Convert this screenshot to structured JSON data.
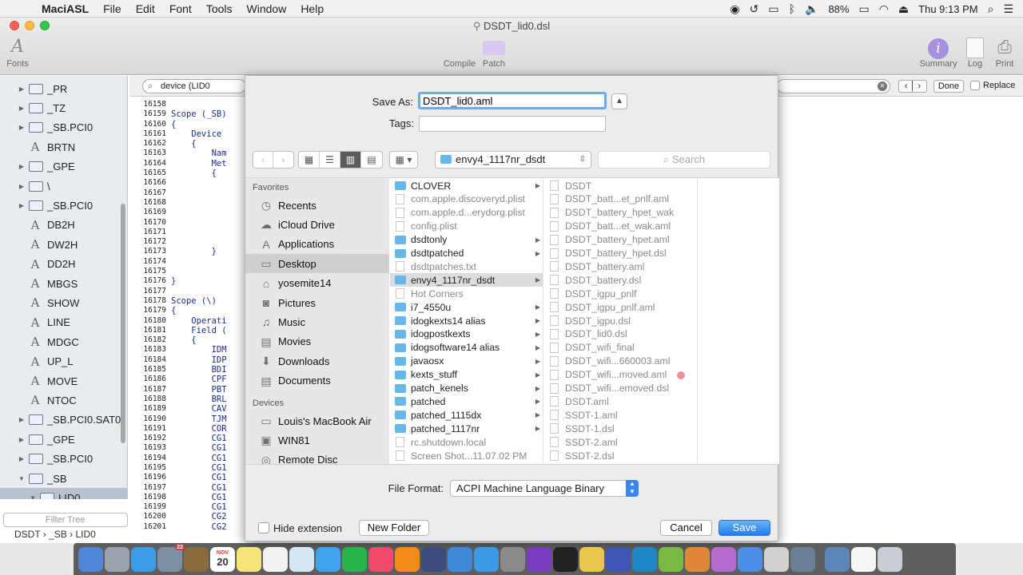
{
  "menubar": {
    "app_name": "MaciASL",
    "menus": [
      "File",
      "Edit",
      "Font",
      "Tools",
      "Window",
      "Help"
    ],
    "battery": "88%",
    "clock": "Thu 9:13 PM"
  },
  "window": {
    "title": "DSDT_lid0.dsl",
    "toolbar": {
      "fonts": "Fonts",
      "compile": "Compile",
      "patch": "Patch",
      "summary": "Summary",
      "log": "Log",
      "print": "Print"
    }
  },
  "tree": {
    "rows": [
      {
        "label": "_PR",
        "kind": "folder",
        "disc": "▶"
      },
      {
        "label": "_TZ",
        "kind": "folder",
        "disc": "▶"
      },
      {
        "label": "_SB.PCI0",
        "kind": "folder",
        "disc": "▶"
      },
      {
        "label": "BRTN",
        "kind": "method",
        "disc": ""
      },
      {
        "label": "_GPE",
        "kind": "folder",
        "disc": "▶"
      },
      {
        "label": "\\",
        "kind": "folder",
        "disc": "▶"
      },
      {
        "label": "_SB.PCI0",
        "kind": "folder",
        "disc": "▶"
      },
      {
        "label": "DB2H",
        "kind": "method",
        "disc": ""
      },
      {
        "label": "DW2H",
        "kind": "method",
        "disc": ""
      },
      {
        "label": "DD2H",
        "kind": "method",
        "disc": ""
      },
      {
        "label": "MBGS",
        "kind": "method",
        "disc": ""
      },
      {
        "label": "SHOW",
        "kind": "method",
        "disc": ""
      },
      {
        "label": "LINE",
        "kind": "method",
        "disc": ""
      },
      {
        "label": "MDGC",
        "kind": "method",
        "disc": ""
      },
      {
        "label": "UP_L",
        "kind": "method",
        "disc": ""
      },
      {
        "label": "MOVE",
        "kind": "method",
        "disc": ""
      },
      {
        "label": "NTOC",
        "kind": "method",
        "disc": ""
      },
      {
        "label": "_SB.PCI0.SAT0",
        "kind": "folder",
        "disc": "▶"
      },
      {
        "label": "_GPE",
        "kind": "folder",
        "disc": "▶"
      },
      {
        "label": "_SB.PCI0",
        "kind": "folder",
        "disc": "▶"
      },
      {
        "label": "_SB",
        "kind": "folder",
        "disc": "▼"
      },
      {
        "label": "LID0",
        "kind": "folder",
        "disc": "▼",
        "selected": true
      }
    ],
    "filter_placeholder": "Filter Tree",
    "breadcrumbs": "DSDT › _SB › LID0"
  },
  "find_bar": {
    "query": "device (LID0",
    "done": "Done",
    "replace": "Replace"
  },
  "editor": {
    "line_numbers": [
      "16158",
      "16159",
      "16160",
      "16161",
      "16162",
      "16163",
      "16164",
      "16165",
      "16166",
      "16167",
      "16168",
      "16169",
      "16170",
      "16171",
      "16172",
      "16173",
      "16174",
      "16175",
      "16176",
      "16177",
      "16178",
      "16179",
      "16180",
      "16181",
      "16182",
      "16183",
      "16184",
      "16185",
      "16186",
      "16187",
      "16188",
      "16189",
      "16190",
      "16191",
      "16192",
      "16193",
      "16194",
      "16195",
      "16196",
      "16197",
      "16198",
      "16199",
      "16200",
      "16201"
    ],
    "code_lines": [
      "",
      "Scope (_SB)",
      "{",
      "    Device",
      "    {",
      "        Nam",
      "        Met",
      "        {",
      "",
      "",
      "",
      "",
      "",
      "",
      "",
      "        }",
      "",
      "",
      "}",
      "",
      "Scope (\\)",
      "{",
      "    Operati",
      "    Field (",
      "    {",
      "        IDM",
      "        IDP",
      "        BDI",
      "        CPF",
      "        PBT",
      "        BRL",
      "        CAV",
      "        TJM",
      "        COR",
      "        CG1",
      "        CG1",
      "        CG1",
      "        CG1",
      "        CG1",
      "        CG1",
      "        CG1",
      "        CG1",
      "        CG2",
      "        CG2"
    ]
  },
  "save_sheet": {
    "save_as_label": "Save As:",
    "save_as_value": "DSDT_lid0.aml",
    "tags_label": "Tags:",
    "location": "envy4_1117nr_dsdt",
    "search_placeholder": "Search",
    "favorites_header": "Favorites",
    "favorites": [
      "Recents",
      "iCloud Drive",
      "Applications",
      "Desktop",
      "yosemite14",
      "Pictures",
      "Music",
      "Movies",
      "Downloads",
      "Documents"
    ],
    "devices_header": "Devices",
    "devices": [
      "Louis's MacBook Air",
      "WIN81",
      "Remote Disc"
    ],
    "column1": [
      {
        "name": "CLOVER",
        "type": "folder",
        "arrow": true
      },
      {
        "name": "com.apple.discoveryd.plist",
        "type": "file"
      },
      {
        "name": "com.apple.d...erydorg.plist",
        "type": "file"
      },
      {
        "name": "config.plist",
        "type": "file"
      },
      {
        "name": "dsdtonly",
        "type": "folder",
        "arrow": true
      },
      {
        "name": "dsdtpatched",
        "type": "folder",
        "arrow": true
      },
      {
        "name": "dsdtpatches.txt",
        "type": "file"
      },
      {
        "name": "envy4_1117nr_dsdt",
        "type": "folder",
        "arrow": true,
        "selected": true
      },
      {
        "name": "Hot Corners",
        "type": "file"
      },
      {
        "name": "i7_4550u",
        "type": "folder",
        "arrow": true
      },
      {
        "name": "idogkexts14 alias",
        "type": "folder",
        "arrow": true
      },
      {
        "name": "idogpostkexts",
        "type": "folder",
        "arrow": true
      },
      {
        "name": "idogsoftware14 alias",
        "type": "folder",
        "arrow": true
      },
      {
        "name": "javaosx",
        "type": "folder",
        "arrow": true
      },
      {
        "name": "kexts_stuff",
        "type": "folder",
        "arrow": true
      },
      {
        "name": "patch_kenels",
        "type": "folder",
        "arrow": true
      },
      {
        "name": "patched",
        "type": "folder",
        "arrow": true
      },
      {
        "name": "patched_1115dx",
        "type": "folder",
        "arrow": true
      },
      {
        "name": "patched_1117nr",
        "type": "folder",
        "arrow": true
      },
      {
        "name": "rc.shutdown.local",
        "type": "file"
      },
      {
        "name": "Screen Shot...11.07.02 PM",
        "type": "file"
      }
    ],
    "column2": [
      "DSDT",
      "DSDT_batt...et_pnlf.aml",
      "DSDT_battery_hpet_wak",
      "DSDT_batt...et_wak.aml",
      "DSDT_battery_hpet.aml",
      "DSDT_battery_hpet.dsl",
      "DSDT_battery.aml",
      "DSDT_battery.dsl",
      "DSDT_igpu_pnlf",
      "DSDT_igpu_pnlf.aml",
      "DSDT_igpu.dsl",
      "DSDT_lid0.dsl",
      "DSDT_wifi_final",
      "DSDT_wifi...660003.aml",
      "DSDT_wifi...moved.aml",
      "DSDT_wifi...emoved.dsl",
      "DSDT.aml",
      "SSDT-1.aml",
      "SSDT-1.dsl",
      "SSDT-2.aml",
      "SSDT-2.dsl"
    ],
    "file_format_label": "File Format:",
    "file_format_value": "ACPI Machine Language Binary",
    "hide_extension": "Hide extension",
    "new_folder": "New Folder",
    "cancel": "Cancel",
    "save": "Save"
  },
  "dock": {
    "calendar_month": "NOV",
    "calendar_day": "20",
    "badge": "22"
  }
}
